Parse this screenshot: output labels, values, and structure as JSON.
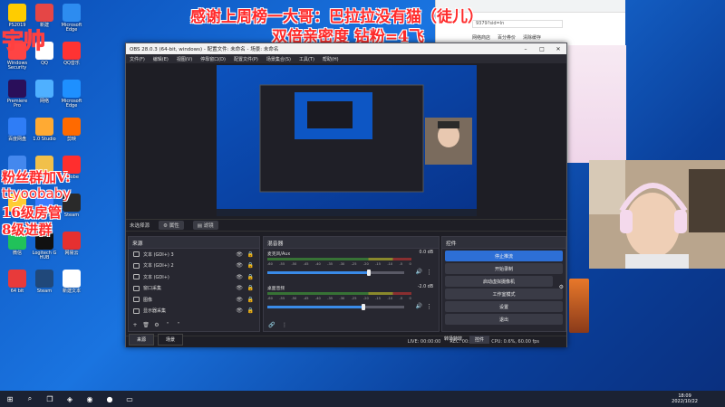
{
  "overlay": {
    "header_line1": "感谢上周榜一大哥：巴拉拉没有猫（徒儿）",
    "header_line2": "双倍亲密度 钻粉=4飞",
    "left_name": "宇帅",
    "fan_group": "粉丝群加V:",
    "wechat_id": "ttyoobaby",
    "rank_line1": "16级房管",
    "rank_line2": "8级进群"
  },
  "desktop_icons": [
    {
      "label": "PS2019",
      "color": "#ffcc00"
    },
    {
      "label": "新建",
      "color": "#e54646"
    },
    {
      "label": "Microsoft Edge",
      "color": "#2d8cf0"
    },
    {
      "label": "Windows Security",
      "color": "#ff4444"
    },
    {
      "label": "QQ",
      "color": "#ffffff"
    },
    {
      "label": "QQ音乐",
      "color": "#ff3333"
    },
    {
      "label": "Premiere Pro",
      "color": "#2a0f5a"
    },
    {
      "label": "网络",
      "color": "#4fb0ff"
    },
    {
      "label": "Microsoft Edge",
      "color": "#1e90ff"
    },
    {
      "label": "百度网盘",
      "color": "#2f7df6"
    },
    {
      "label": "1.0 Studio",
      "color": "#ffaa33"
    },
    {
      "label": "剪映",
      "color": "#ff6a00"
    },
    {
      "label": "腾讯",
      "color": "#4488ee"
    },
    {
      "label": "文件夹",
      "color": "#f1c04a"
    },
    {
      "label": "Adobe",
      "color": "#ff2e2e"
    },
    {
      "label": "YY",
      "color": "#ffcc33"
    },
    {
      "label": "EV录屏",
      "color": "#3a7cff"
    },
    {
      "label": "Steam",
      "color": "#2a2a2a"
    },
    {
      "label": "微信",
      "color": "#21c25a"
    },
    {
      "label": "Logitech G HUB",
      "color": "#111111"
    },
    {
      "label": "网易云",
      "color": "#e63030"
    },
    {
      "label": "64 bit",
      "color": "#e83a3a"
    },
    {
      "label": "Steam",
      "color": "#20487a"
    },
    {
      "label": "新建文本",
      "color": "#ffffff"
    }
  ],
  "browser": {
    "bookmarks": [
      "网络商店",
      "百分券价",
      "清除缓存"
    ],
    "url_fragment": "9379?sid=ln"
  },
  "obs": {
    "title": "OBS 28.0.3 (64-bit, windows) - 配置文件: 未命名 - 场景: 未命名",
    "menu": [
      "文件(F)",
      "编辑(E)",
      "视图(V)",
      "停靠窗口(D)",
      "配置文件(P)",
      "场景集合(S)",
      "工具(T)",
      "帮助(H)"
    ],
    "status_left": "未选择源",
    "status_props": "属性",
    "status_filters": "滤镜",
    "sources_title": "来源",
    "sources": [
      {
        "name": "文本 (GDI+) 3",
        "selected": false
      },
      {
        "name": "文本 (GDI+) 2",
        "selected": false
      },
      {
        "name": "文本 (GDI+)",
        "selected": false
      },
      {
        "name": "窗口采集",
        "selected": false
      },
      {
        "name": "图像",
        "selected": false
      },
      {
        "name": "显示器采集",
        "selected": false
      }
    ],
    "mixer_title": "混音器",
    "mixer_channels": [
      {
        "name": "麦克风/Aux",
        "db": "0.0 dB",
        "level": 0.74
      },
      {
        "name": "桌面音频",
        "db": "-2.0 dB",
        "level": 0.7
      }
    ],
    "meter_scale": [
      "-60",
      "-55",
      "-50",
      "-45",
      "-40",
      "-35",
      "-30",
      "-25",
      "-20",
      "-15",
      "-10",
      "-5",
      "0"
    ],
    "controls_title": "控件",
    "controls": [
      "停止推流",
      "开始录制",
      "启动虚拟摄像机",
      "工作室模式",
      "设置",
      "退出"
    ],
    "scene_tab": "来源",
    "scene_tab2": "场景",
    "transitions_label": "转场特效",
    "transitions_control": "控件",
    "live_status": "LIVE: 00:00:00",
    "rec_status": "REC: 00:00:00",
    "cpu_status": "CPU: 0.6%, 60.00 fps"
  },
  "taskbar": {
    "time": "18:09",
    "date": "2022/10/22"
  }
}
